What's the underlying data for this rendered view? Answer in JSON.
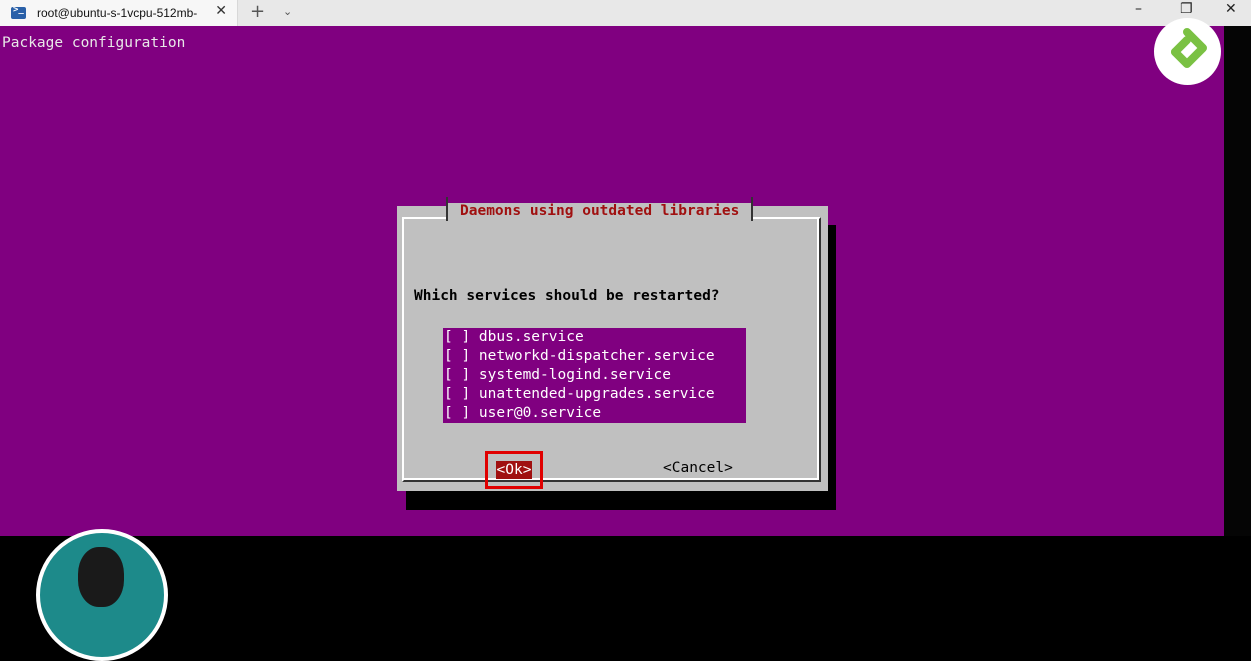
{
  "window": {
    "tab_title": "root@ubuntu-s-1vcpu-512mb-",
    "tab_close": "✕",
    "new_tab": "+",
    "tab_dropdown": "⌄",
    "minimize": "–",
    "restore": "❐",
    "close": "✕"
  },
  "terminal": {
    "header": "Package configuration",
    "background_color": "#800080"
  },
  "dialog": {
    "title": "Daemons using outdated libraries",
    "question": "Which services should be restarted?",
    "services": [
      "[ ] dbus.service",
      "[ ] networkd-dispatcher.service",
      "[ ] systemd-logind.service",
      "[ ] unattended-upgrades.service",
      "[ ] user@0.service"
    ],
    "ok_label": "<Ok>",
    "cancel_label": "<Cancel>"
  },
  "overlays": {
    "logo_icon": "channel-logo-icon",
    "avatar": "presenter-avatar",
    "highlight_color": "#e00000"
  }
}
